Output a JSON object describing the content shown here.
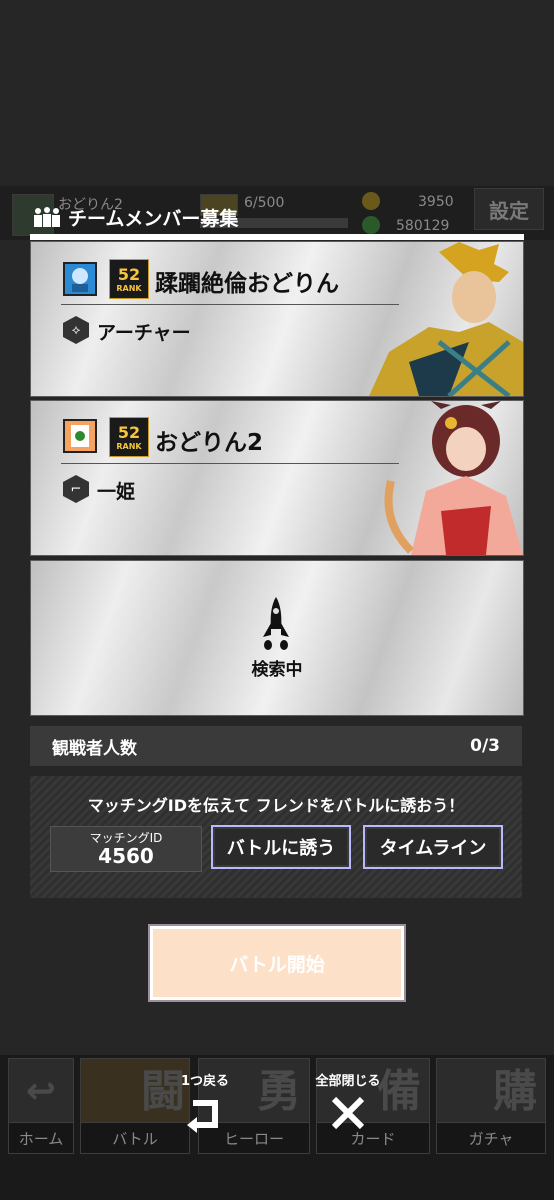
{
  "status_bar": {
    "player_name": "おどりん2",
    "stamina": "6/500",
    "coins": "3950",
    "points": "580129",
    "settings_label": "設定"
  },
  "panel": {
    "title": "チームメンバー募集"
  },
  "members": [
    {
      "rank": "52",
      "rank_label": "RANK",
      "name": "蹂躙絶倫おどりん",
      "class_name": "アーチャー",
      "class_icon": "archer-icon"
    },
    {
      "rank": "52",
      "rank_label": "RANK",
      "name": "おどりん2",
      "class_name": "一姫",
      "class_icon": "boot-icon"
    }
  ],
  "search_slot": {
    "label": "検索中",
    "icon": "rocket-icon"
  },
  "spectators": {
    "label": "観戦者人数",
    "value": "0/3"
  },
  "matching": {
    "message": "マッチングIDを伝えて フレンドをバトルに誘おう！",
    "id_label": "マッチングID",
    "id_value": "4560",
    "invite_button": "バトルに誘う",
    "timeline_button": "タイムライン"
  },
  "start_button": "バトル開始",
  "overlay": {
    "back_label": "1つ戻る",
    "close_all_label": "全部閉じる"
  },
  "nav": [
    {
      "label": "ホーム",
      "glyph": "↩"
    },
    {
      "label": "バトル",
      "glyph": "闘"
    },
    {
      "label": "ヒーロー",
      "glyph": "勇"
    },
    {
      "label": "カード",
      "glyph": "備"
    },
    {
      "label": "ガチャ",
      "glyph": "購"
    }
  ],
  "colors": {
    "accent_gold": "#f6c640",
    "button_border": "#b9b9ff",
    "start_button_bg": "#fde0c8"
  }
}
